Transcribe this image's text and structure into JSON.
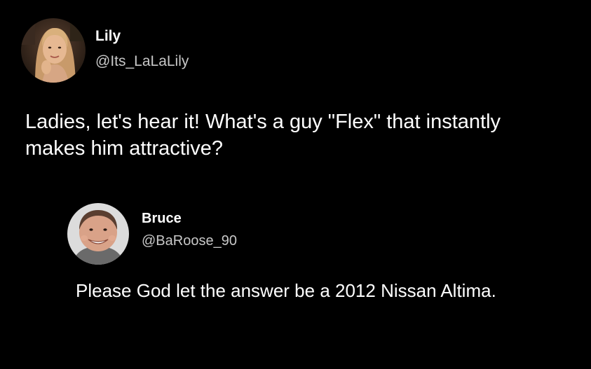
{
  "main_tweet": {
    "display_name": "Lily",
    "handle": "@Its_LaLaLily",
    "text": "Ladies, let's hear it! What's a guy \"Flex\" that instantly makes him attractive?",
    "avatar_icon": "user-photo-icon"
  },
  "reply_tweet": {
    "display_name": "Bruce",
    "handle": "@BaRoose_90",
    "text": "Please God let the answer be a 2012 Nissan Altima.",
    "avatar_icon": "user-photo-icon"
  },
  "colors": {
    "background": "#000000",
    "text": "#ffffff",
    "secondary_text": "#c8c8c8"
  }
}
